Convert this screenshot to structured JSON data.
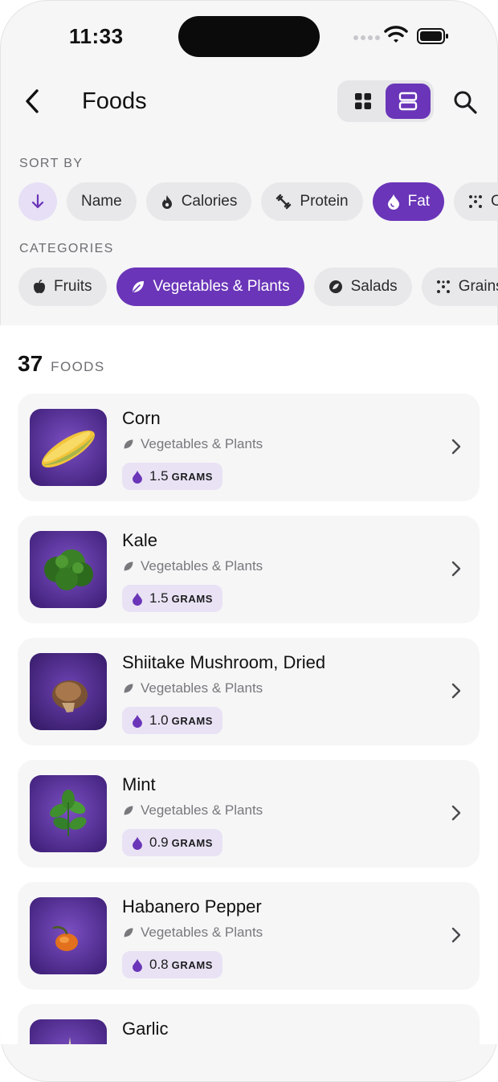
{
  "status_bar": {
    "time": "11:33"
  },
  "header": {
    "title": "Foods"
  },
  "sort": {
    "label": "SORT BY",
    "options": [
      "Name",
      "Calories",
      "Protein",
      "Fat",
      "Ca"
    ],
    "selected": "Fat"
  },
  "categories": {
    "label": "CATEGORIES",
    "options": [
      "Fruits",
      "Vegetables & Plants",
      "Salads",
      "Grains &"
    ],
    "selected": "Vegetables & Plants"
  },
  "summary": {
    "count": "37",
    "label": "FOODS"
  },
  "foods": [
    {
      "name": "Corn",
      "category": "Vegetables & Plants",
      "value": "1.5",
      "unit": "GRAMS",
      "icon": "corn-icon"
    },
    {
      "name": "Kale",
      "category": "Vegetables & Plants",
      "value": "1.5",
      "unit": "GRAMS",
      "icon": "kale-icon"
    },
    {
      "name": "Shiitake Mushroom, Dried",
      "category": "Vegetables & Plants",
      "value": "1.0",
      "unit": "GRAMS",
      "icon": "mushroom-icon"
    },
    {
      "name": "Mint",
      "category": "Vegetables & Plants",
      "value": "0.9",
      "unit": "GRAMS",
      "icon": "mint-icon"
    },
    {
      "name": "Habanero Pepper",
      "category": "Vegetables & Plants",
      "value": "0.8",
      "unit": "GRAMS",
      "icon": "pepper-icon"
    },
    {
      "name": "Garlic",
      "category": "",
      "value": "",
      "unit": "",
      "icon": "garlic-icon"
    }
  ],
  "colors": {
    "accent": "#6a35b8",
    "badge_bg": "#e9e2f4",
    "card_bg": "#f6f6f7"
  }
}
